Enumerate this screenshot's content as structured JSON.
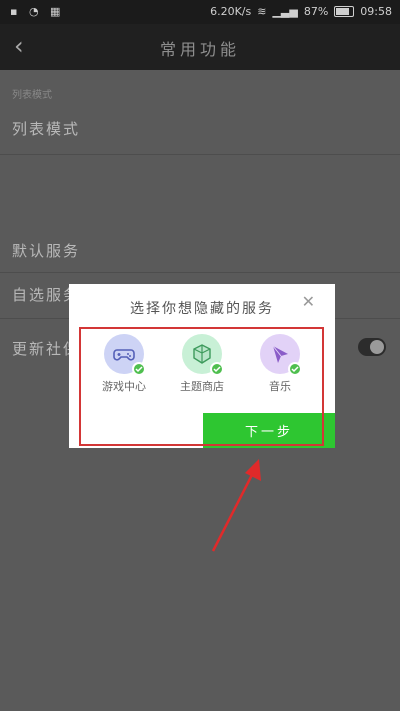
{
  "status_bar": {
    "speed": "6.20K/s",
    "battery": "87%",
    "time": "09:58"
  },
  "header": {
    "title": "常用功能"
  },
  "list": {
    "section_label": "列表模式",
    "rows": [
      "列表模式",
      "默认服务",
      "自选服务",
      "更新社保"
    ]
  },
  "dialog": {
    "title": "选择你想隐藏的服务",
    "items": [
      {
        "label": "游戏中心",
        "icon": "gamepad-icon",
        "color": "#cdd3f5"
      },
      {
        "label": "主题商店",
        "icon": "cube-icon",
        "color": "#c8f0d6"
      },
      {
        "label": "音乐",
        "icon": "music-icon",
        "color": "#e2d2f7"
      }
    ],
    "next_label": "下一步"
  },
  "colors": {
    "accent": "#2ec631",
    "highlight": "#d33636"
  }
}
